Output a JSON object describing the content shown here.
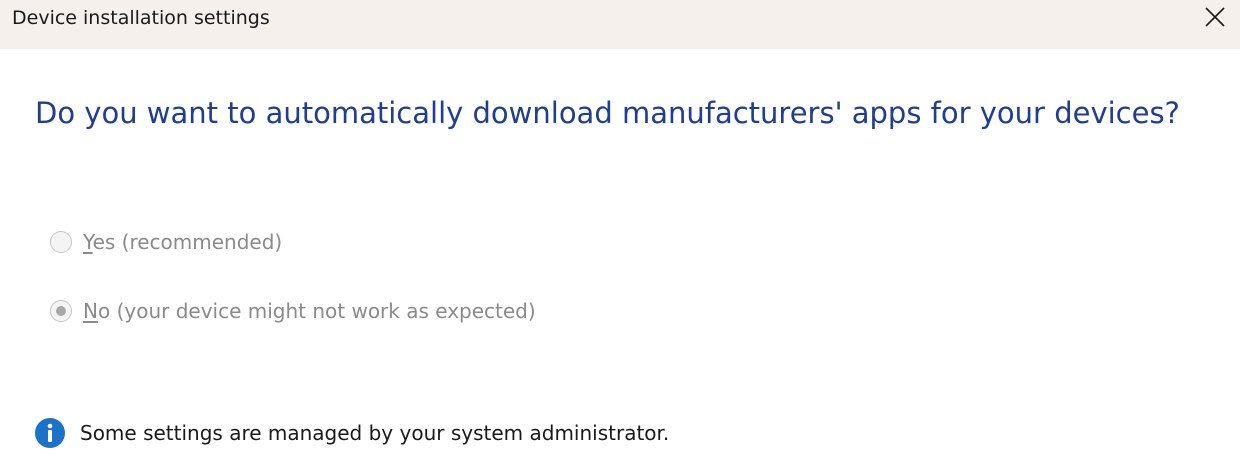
{
  "window": {
    "title": "Device installation settings"
  },
  "heading": "Do you want to automatically download manufacturers' apps for your devices?",
  "options": [
    {
      "accelerator": "Y",
      "rest": "es (recommended)",
      "checked": false,
      "enabled": false
    },
    {
      "accelerator": "N",
      "rest": "o (your device might not work as expected)",
      "checked": true,
      "enabled": false
    }
  ],
  "info": {
    "icon": "info-icon",
    "text": "Some settings are managed by your system administrator."
  },
  "colors": {
    "titlebar": "#f6f0ec",
    "heading": "#1e3d94",
    "info_icon": "#1a73c8",
    "disabled_text": "#8a8a8a"
  }
}
